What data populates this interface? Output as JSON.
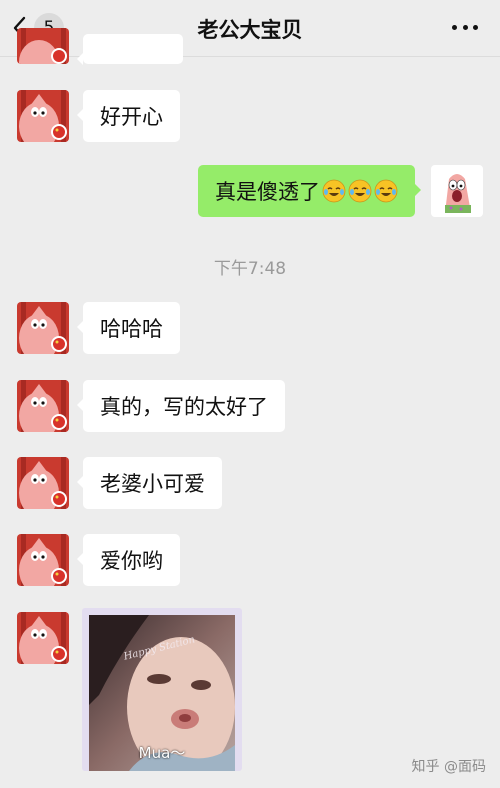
{
  "header": {
    "badge_count": "5",
    "title": "老公大宝贝"
  },
  "messages": [
    {
      "side": "left",
      "text": "好开心"
    },
    {
      "side": "right",
      "text": "真是傻透了",
      "emojis": [
        "laughing-crying-emoji",
        "laughing-crying-emoji",
        "laughing-crying-emoji"
      ]
    },
    {
      "side": "left",
      "text": "哈哈哈"
    },
    {
      "side": "left",
      "text": "真的，写的太好了"
    },
    {
      "side": "left",
      "text": "老婆小可爱"
    },
    {
      "side": "left",
      "text": "爱你哟"
    }
  ],
  "timestamp": "下午7:48",
  "photo": {
    "caption": "Mua～",
    "script_text": "Happy Station"
  },
  "watermark": "知乎 @面码",
  "colors": {
    "background": "#ededed",
    "sent_bubble": "#95ec69",
    "received_bubble": "#ffffff",
    "avatar_red": "#d8322a",
    "patrick_pink": "#f2a7a3"
  }
}
